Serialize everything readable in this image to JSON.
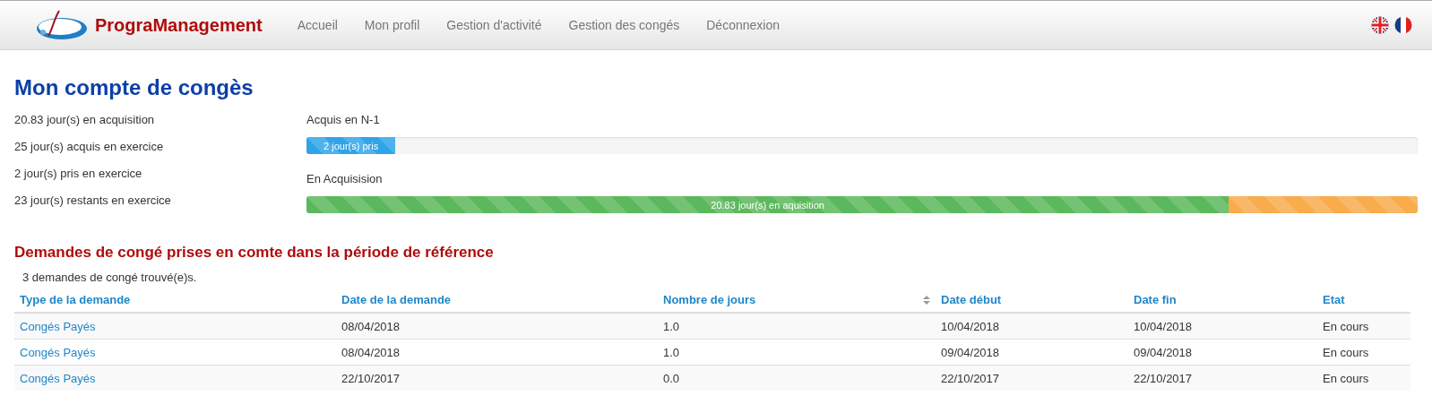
{
  "navbar": {
    "brand": "PrograManagement",
    "links": [
      {
        "label": "Accueil"
      },
      {
        "label": "Mon profil"
      },
      {
        "label": "Gestion d'activité"
      },
      {
        "label": "Gestion des congés"
      },
      {
        "label": "Déconnexion"
      }
    ]
  },
  "title": "Mon compte de congès",
  "stats": [
    "20.83 jour(s) en acquisition",
    "25 jour(s) acquis en exercice",
    "2 jour(s) pris en exercice",
    "23 jour(s) restants en exercice"
  ],
  "progress": [
    {
      "label": "Acquis en N-1",
      "segments": [
        {
          "kind": "info",
          "level": 0.08,
          "text": "2 jour(s) pris"
        }
      ]
    },
    {
      "label": "En Acquisision",
      "segments": [
        {
          "kind": "success",
          "level": 0.83,
          "text": "20.83 jour(s) en aquisition"
        },
        {
          "kind": "warning",
          "level": 0.17
        }
      ]
    }
  ],
  "section_title": "Demandes de congé prises en comte dans la période de référence",
  "count": "3 demandes de congé trouvé(e)s.",
  "table": {
    "columns": [
      {
        "label": "Type de la demande",
        "sortable": false
      },
      {
        "label": "Date de la demande",
        "sortable": false
      },
      {
        "label": "Nombre de jours",
        "sortable": true
      },
      {
        "label": "Date début",
        "sortable": false
      },
      {
        "label": "Date fin",
        "sortable": false
      },
      {
        "label": "Etat",
        "sortable": false
      }
    ],
    "rows": [
      [
        "Congés Payés",
        "08/04/2018",
        "1.0",
        "10/04/2018",
        "10/04/2018",
        "En cours"
      ],
      [
        "Congés Payés",
        "08/04/2018",
        "1.0",
        "09/04/2018",
        "09/04/2018",
        "En cours"
      ],
      [
        "Congés Payés",
        "22/10/2017",
        "0.0",
        "22/10/2017",
        "22/10/2017",
        "En cours"
      ]
    ]
  }
}
